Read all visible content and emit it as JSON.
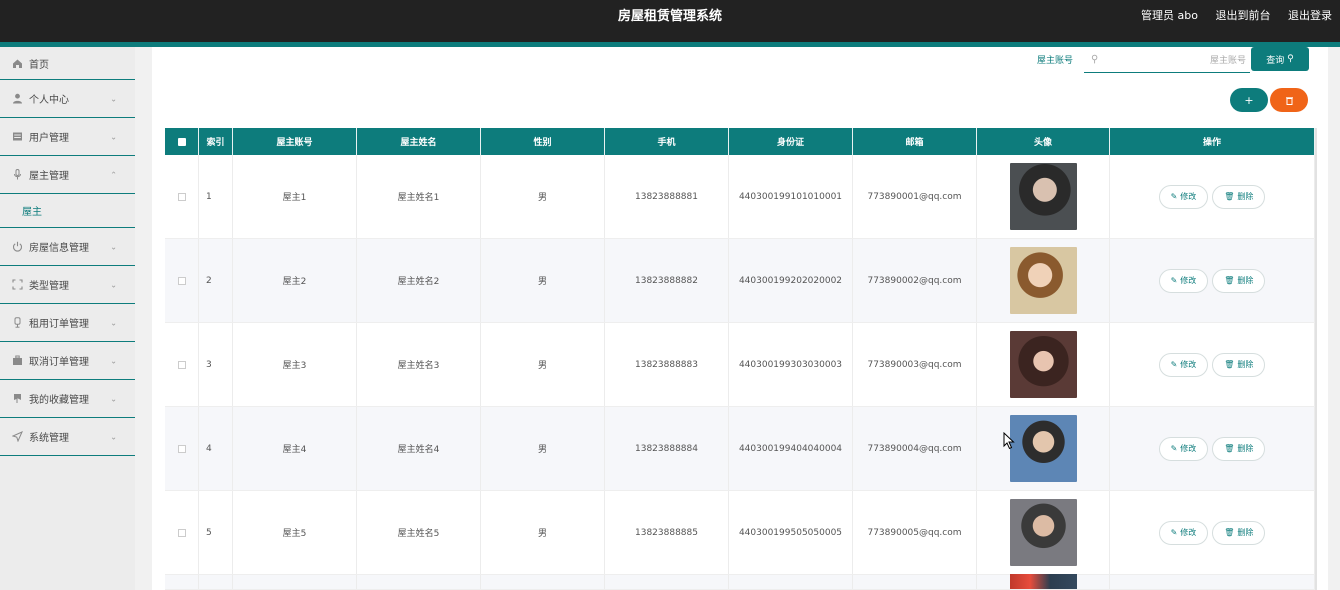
{
  "header": {
    "title": "房屋租赁管理系统",
    "admin": "管理员 abo",
    "back_front": "退出到前台",
    "logout": "退出登录"
  },
  "sidebar": {
    "items": [
      {
        "label": "首页",
        "icon": "home-icon"
      },
      {
        "label": "个人中心",
        "icon": "user-icon"
      },
      {
        "label": "用户管理",
        "icon": "table-icon"
      },
      {
        "label": "屋主管理",
        "icon": "mic-icon"
      },
      {
        "label": "房屋信息管理",
        "icon": "power-icon"
      },
      {
        "label": "类型管理",
        "icon": "expand-icon"
      },
      {
        "label": "租用订单管理",
        "icon": "lamp-icon"
      },
      {
        "label": "取消订单管理",
        "icon": "briefcase-icon"
      },
      {
        "label": "我的收藏管理",
        "icon": "bookmark-icon"
      },
      {
        "label": "系统管理",
        "icon": "send-icon"
      }
    ],
    "sub_item": "屋主"
  },
  "search": {
    "label": "屋主账号",
    "placeholder": "屋主账号",
    "button": "查询"
  },
  "actions": {
    "add": "+",
    "delete_icon": "trash-icon"
  },
  "table": {
    "headers": [
      "索引",
      "屋主账号",
      "屋主姓名",
      "性别",
      "手机",
      "身份证",
      "邮箱",
      "头像",
      "操作"
    ],
    "rows": [
      {
        "index": "1",
        "account": "屋主1",
        "name": "屋主姓名1",
        "sex": "男",
        "phone": "13823888881",
        "id_card": "440300199101010001",
        "email": "773890001@qq.com"
      },
      {
        "index": "2",
        "account": "屋主2",
        "name": "屋主姓名2",
        "sex": "男",
        "phone": "13823888882",
        "id_card": "440300199202020002",
        "email": "773890002@qq.com"
      },
      {
        "index": "3",
        "account": "屋主3",
        "name": "屋主姓名3",
        "sex": "男",
        "phone": "13823888883",
        "id_card": "440300199303030003",
        "email": "773890003@qq.com"
      },
      {
        "index": "4",
        "account": "屋主4",
        "name": "屋主姓名4",
        "sex": "男",
        "phone": "13823888884",
        "id_card": "440300199404040004",
        "email": "773890004@qq.com"
      },
      {
        "index": "5",
        "account": "屋主5",
        "name": "屋主姓名5",
        "sex": "男",
        "phone": "13823888885",
        "id_card": "440300199505050005",
        "email": "773890005@qq.com"
      }
    ],
    "edit_label": "修改",
    "delete_label": "删除"
  },
  "colors": {
    "accent": "#0d7c7c",
    "danger": "#f06418",
    "topbar": "#222222"
  }
}
